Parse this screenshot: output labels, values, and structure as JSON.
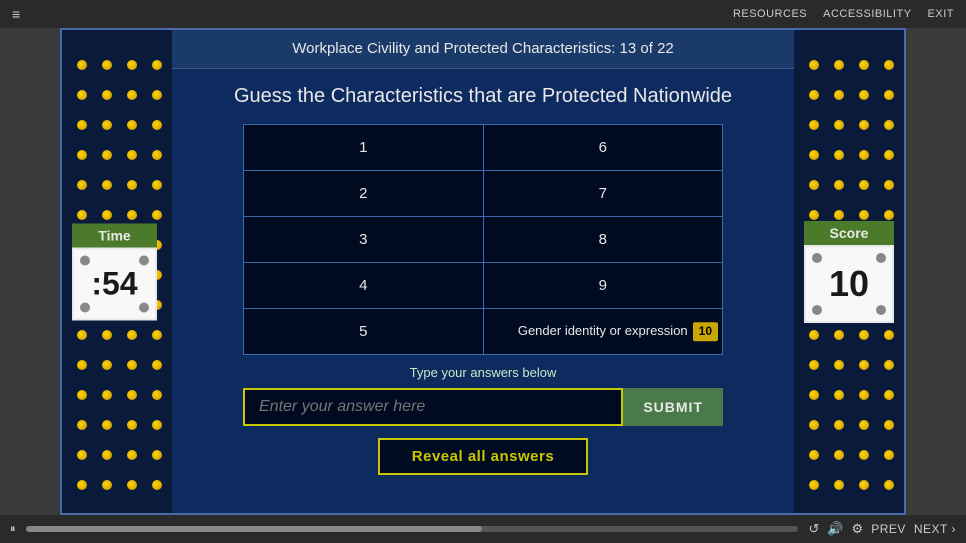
{
  "topbar": {
    "menu_icon": "≡",
    "resources": "RESOURCES",
    "accessibility": "ACCESSIBILITY",
    "exit": "EXIT"
  },
  "page_title": "Workplace Civility and Protected Characteristics: 13 of 22",
  "question": {
    "title": "Guess the Characteristics that are Protected Nationwide",
    "grid": [
      {
        "number": "1",
        "answer": "",
        "col": "left"
      },
      {
        "number": "6",
        "answer": "",
        "col": "right"
      },
      {
        "number": "2",
        "answer": "",
        "col": "left"
      },
      {
        "number": "7",
        "answer": "",
        "col": "right"
      },
      {
        "number": "3",
        "answer": "",
        "col": "left"
      },
      {
        "number": "8",
        "answer": "",
        "col": "right"
      },
      {
        "number": "4",
        "answer": "",
        "col": "left"
      },
      {
        "number": "9",
        "answer": "",
        "col": "right"
      },
      {
        "number": "5",
        "answer": "",
        "col": "left"
      },
      {
        "number": "10_answered",
        "answer": "Gender identity or\nexpression",
        "score": "10",
        "col": "right"
      }
    ],
    "rows": [
      {
        "left_num": "1",
        "left_answer": "",
        "right_num": "6",
        "right_answer": "",
        "right_score": ""
      },
      {
        "left_num": "2",
        "left_answer": "",
        "right_num": "7",
        "right_answer": "",
        "right_score": ""
      },
      {
        "left_num": "3",
        "left_answer": "",
        "right_num": "8",
        "right_answer": "",
        "right_score": ""
      },
      {
        "left_num": "4",
        "left_answer": "",
        "right_num": "9",
        "right_answer": "",
        "right_score": ""
      },
      {
        "left_num": "5",
        "left_answer": "",
        "right_num": "",
        "right_answer": "Gender identity or expression",
        "right_score": "10"
      }
    ],
    "instructions": "Type your answers below",
    "input_placeholder": "Enter your answer here",
    "submit_label": "SUBMIT",
    "reveal_label": "Reveal all answers"
  },
  "time_panel": {
    "label": "Time",
    "value": ":54"
  },
  "score_panel": {
    "label": "Score",
    "value": "10"
  },
  "progress": {
    "percent": 59
  },
  "nav": {
    "prev": "PREV",
    "next": "NEXT ›"
  }
}
